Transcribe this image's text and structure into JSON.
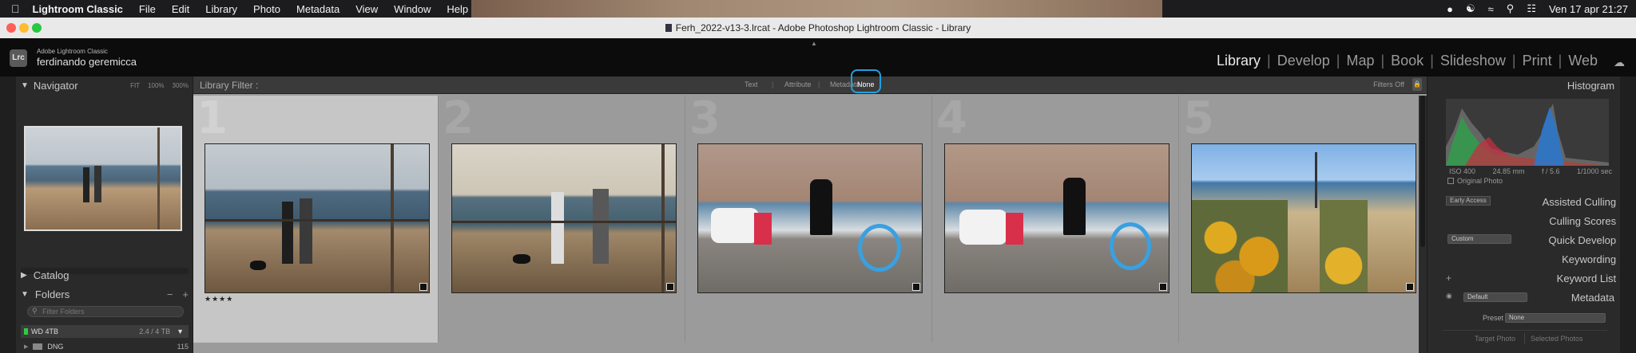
{
  "menubar": {
    "app_name": "Lightroom Classic",
    "items": [
      "File",
      "Edit",
      "Library",
      "Photo",
      "Metadata",
      "View",
      "Window",
      "Help"
    ],
    "clock": "Ven 17 apr  21:27"
  },
  "window": {
    "title": "Ferh_2022-v13-3.lrcat - Adobe Photoshop Lightroom Classic - Library"
  },
  "identity": {
    "product": "Adobe Lightroom Classic",
    "user": "ferdinando geremicca",
    "badge": "Lrc"
  },
  "modules": [
    "Library",
    "Develop",
    "Map",
    "Book",
    "Slideshow",
    "Print",
    "Web"
  ],
  "left_panel": {
    "navigator": {
      "title": "Navigator",
      "zoom_options": [
        "FIT",
        "100%",
        "300%"
      ]
    },
    "catalog": "Catalog",
    "folders": {
      "title": "Folders",
      "search_placeholder": "Filter Folders",
      "volume": "WD 4TB",
      "volume_size": "2.4 / 4 TB",
      "folder": "DNG",
      "folder_count": "115"
    }
  },
  "filter_bar": {
    "label": "Library Filter :",
    "tabs": [
      "Text",
      "Attribute",
      "Metadata",
      "None"
    ],
    "active": "None",
    "status": "Filters Off"
  },
  "grid": {
    "cells": [
      {
        "index": "1",
        "rating": "★★★★",
        "selected": true
      },
      {
        "index": "2",
        "rating": "",
        "selected": false
      },
      {
        "index": "3",
        "rating": "",
        "selected": false
      },
      {
        "index": "4",
        "rating": "",
        "selected": false
      },
      {
        "index": "5",
        "rating": "",
        "selected": false
      }
    ]
  },
  "right_panel": {
    "histogram": {
      "title": "Histogram",
      "iso": "ISO 400",
      "focal": "24.85 mm",
      "aperture": "f / 5.6",
      "shutter": "1/1000 sec",
      "original_photo": "Original Photo"
    },
    "early_access": "Early Access",
    "assisted_culling": "Assisted Culling",
    "culling_scores": "Culling Scores",
    "quick_develop": {
      "title": "Quick Develop",
      "preset": "Custom"
    },
    "keywording": "Keywording",
    "keyword_list": "Keyword List",
    "metadata": {
      "title": "Metadata",
      "preset_select": "Default",
      "preset_label": "Preset",
      "preset_value": "None"
    },
    "buttons": [
      "Target Photo",
      "Selected Photos"
    ]
  },
  "colors": {
    "accent": "#1ea0e0",
    "panel": "#2a2a2a",
    "grid": "#9b9b9b"
  }
}
